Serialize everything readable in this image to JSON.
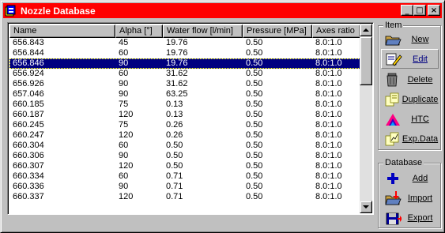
{
  "window": {
    "title": "Nozzle Database",
    "icon": "nozzle-app-icon",
    "controls": {
      "minimize": "_",
      "maximize": "□",
      "close": "×"
    }
  },
  "table": {
    "columns": [
      "Name",
      "Alpha [°]",
      "Water flow [l/min]",
      "Pressure [MPa]",
      "Axes ratio"
    ],
    "rows": [
      [
        "656.843",
        "45",
        "19.76",
        "0.50",
        "8.0:1.0"
      ],
      [
        "656.844",
        "60",
        "19.76",
        "0.50",
        "8.0:1.0"
      ],
      [
        "656.846",
        "90",
        "19.76",
        "0.50",
        "8.0:1.0"
      ],
      [
        "656.924",
        "60",
        "31.62",
        "0.50",
        "8.0:1.0"
      ],
      [
        "656.926",
        "90",
        "31.62",
        "0.50",
        "8.0:1.0"
      ],
      [
        "657.046",
        "90",
        "63.25",
        "0.50",
        "8.0:1.0"
      ],
      [
        "660.185",
        "75",
        "0.13",
        "0.50",
        "8.0:1.0"
      ],
      [
        "660.187",
        "120",
        "0.13",
        "0.50",
        "8.0:1.0"
      ],
      [
        "660.245",
        "75",
        "0.26",
        "0.50",
        "8.0:1.0"
      ],
      [
        "660.247",
        "120",
        "0.26",
        "0.50",
        "8.0:1.0"
      ],
      [
        "660.304",
        "60",
        "0.50",
        "0.50",
        "8.0:1.0"
      ],
      [
        "660.306",
        "90",
        "0.50",
        "0.50",
        "8.0:1.0"
      ],
      [
        "660.307",
        "120",
        "0.50",
        "0.50",
        "8.0:1.0"
      ],
      [
        "660.334",
        "60",
        "0.71",
        "0.50",
        "8.0:1.0"
      ],
      [
        "660.336",
        "90",
        "0.71",
        "0.50",
        "8.0:1.0"
      ],
      [
        "660.337",
        "120",
        "0.71",
        "0.50",
        "8.0:1.0"
      ]
    ],
    "selected_row_index": 2
  },
  "item_group": {
    "label": "Item",
    "buttons": [
      {
        "name": "new-button",
        "label": "New",
        "icon": "folder-open-icon"
      },
      {
        "name": "edit-button",
        "label": "Edit",
        "icon": "edit-pencil-icon"
      },
      {
        "name": "delete-button",
        "label": "Delete",
        "icon": "trash-can-icon"
      },
      {
        "name": "duplicate-button",
        "label": "Duplicate",
        "icon": "duplicate-pages-icon"
      },
      {
        "name": "htc-button",
        "label": "HTC",
        "icon": "htc-plot-icon"
      },
      {
        "name": "exp-data-button",
        "label": "Exp.Data",
        "icon": "exp-data-icon"
      }
    ]
  },
  "database_group": {
    "label": "Database",
    "buttons": [
      {
        "name": "add-button",
        "label": "Add",
        "icon": "plus-icon"
      },
      {
        "name": "import-button",
        "label": "Import",
        "icon": "import-icon"
      },
      {
        "name": "export-button",
        "label": "Export",
        "icon": "export-icon"
      }
    ]
  },
  "colors": {
    "title_bar": "#ff0000",
    "selection": "#000080",
    "face": "#c0c0c0"
  }
}
